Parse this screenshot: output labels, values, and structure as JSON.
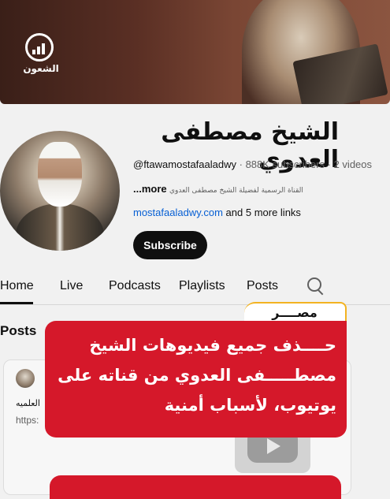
{
  "logo": {
    "text": "الشعون"
  },
  "channel": {
    "name": "الشيخ مصطفى العدوي",
    "handle": "@ftawamostafaaladwy",
    "subscribers": "888K subscribers",
    "videos": "2 videos",
    "description_more": "...more",
    "description": "القناة الرسمية لفضيلة الشيخ مصطفى العدوي",
    "link": "mostafaaladwy.com",
    "more_links": "and 5 more links",
    "subscribe_label": "Subscribe"
  },
  "tabs": [
    {
      "label": "Home"
    },
    {
      "label": "Live"
    },
    {
      "label": "Podcasts"
    },
    {
      "label": "Playlists"
    },
    {
      "label": "Posts"
    }
  ],
  "posts": {
    "section_title": "Posts",
    "text_partial": "العلميه",
    "link_partial": "https:"
  },
  "news": {
    "tag": "مصــــر",
    "headline": "حــــذف جميع فيديوهات الشيخ مصطـــــفى العدوي من قناته على يوتيوب، لأسباب أمنية",
    "accent": "#d5182a"
  }
}
